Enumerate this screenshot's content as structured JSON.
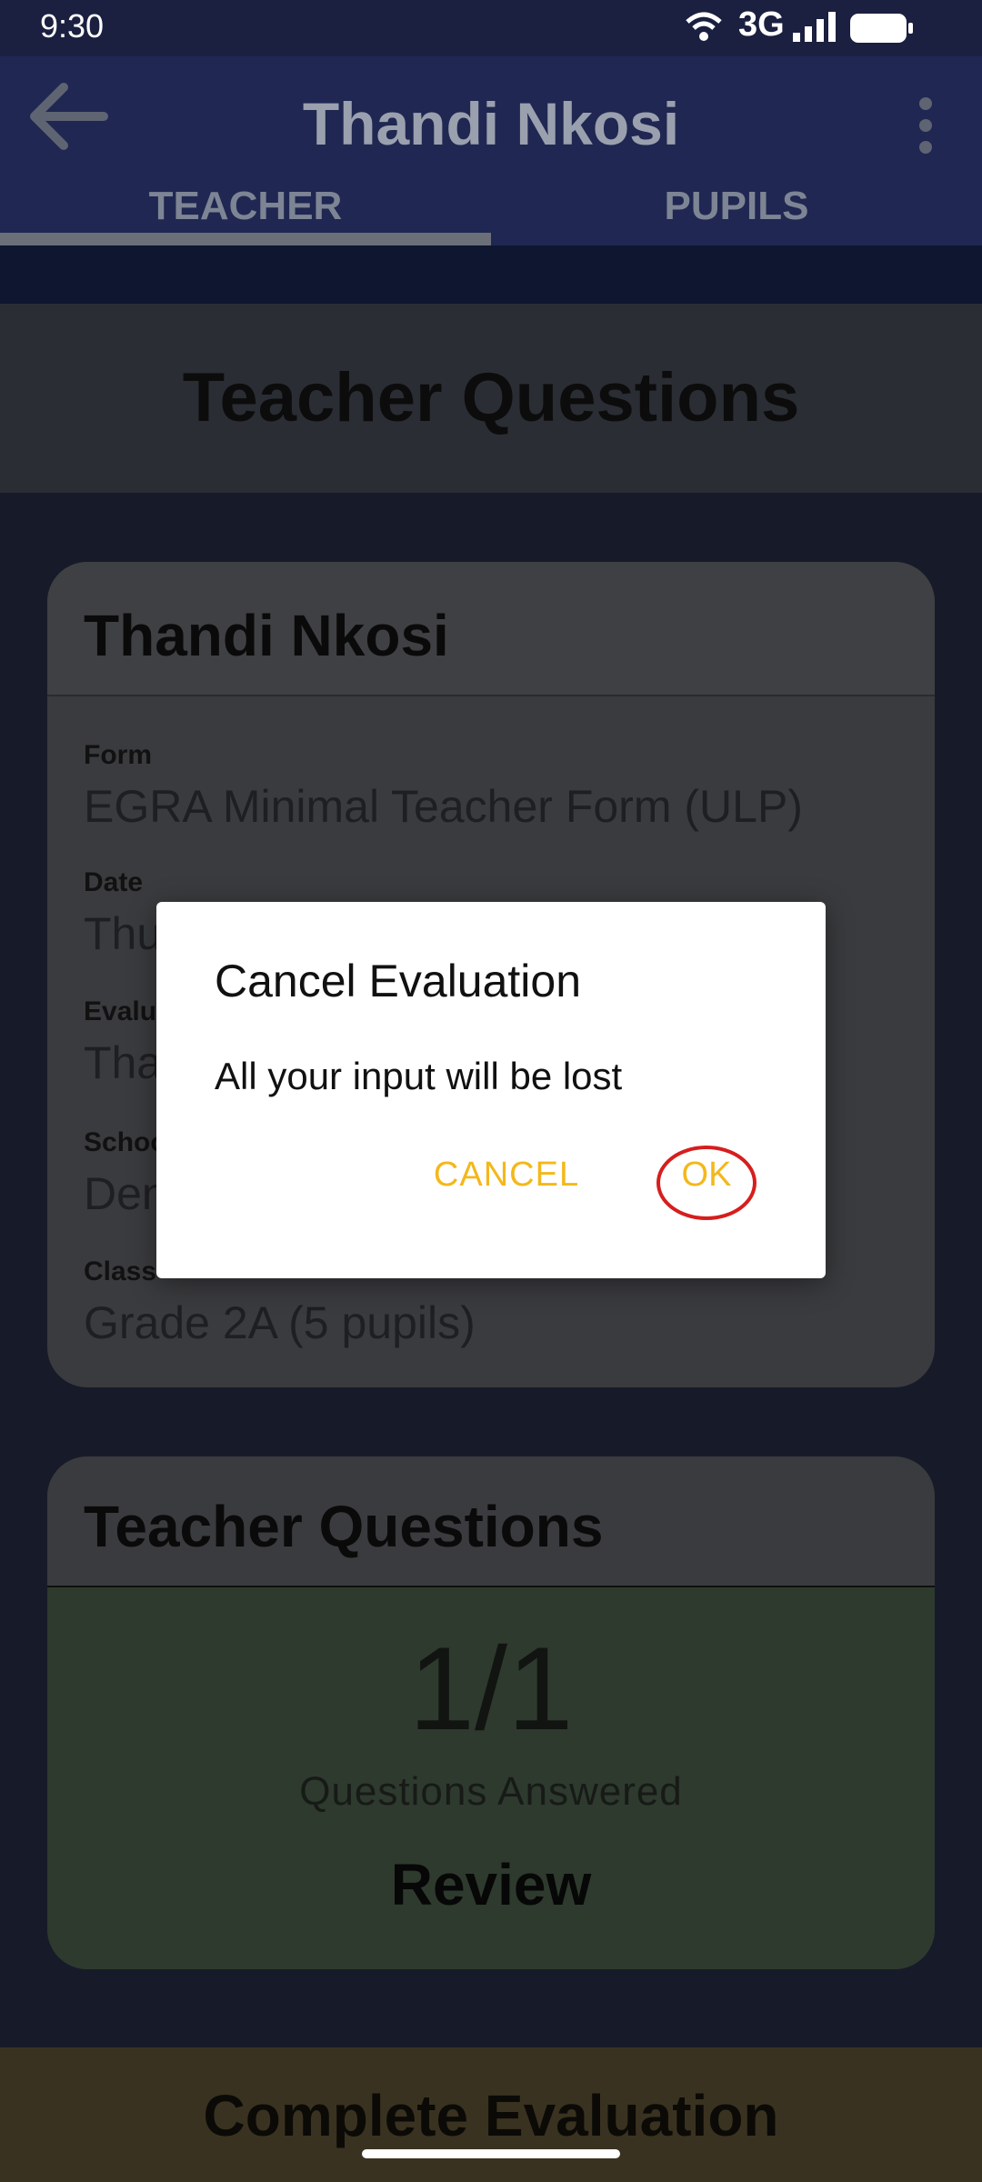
{
  "status_bar": {
    "time": "9:30",
    "network": "3G",
    "icons": [
      "wifi-icon",
      "signal-icon",
      "battery-icon"
    ]
  },
  "app_bar": {
    "title": "Thandi Nkosi",
    "back_icon": "arrow-back-icon",
    "menu_icon": "more-vert-icon"
  },
  "tabs": [
    {
      "label": "TEACHER",
      "selected": true
    },
    {
      "label": "PUPILS",
      "selected": false
    }
  ],
  "page_title": "Teacher Questions",
  "info_card": {
    "title": "Thandi Nkosi",
    "fields": [
      {
        "label": "Form",
        "value": "EGRA Minimal Teacher Form (ULP)"
      },
      {
        "label": "Date",
        "value": "Thu"
      },
      {
        "label": "Evalu",
        "value": "Tha"
      },
      {
        "label": "Schoo",
        "value": "Den"
      },
      {
        "label": "Class",
        "value": "Grade 2A (5 pupils)"
      }
    ]
  },
  "questions_card": {
    "title": "Teacher Questions",
    "count": "1/1",
    "caption": "Questions Answered",
    "action": "Review"
  },
  "bottom_action": "Complete Evaluation",
  "dialog": {
    "title": "Cancel Evaluation",
    "message": "All your input will be lost",
    "cancel_label": "CANCEL",
    "ok_label": "OK"
  },
  "colors": {
    "accent": "#f3b81b",
    "highlight": "#d61e1e",
    "app_bar": "#1f2752"
  }
}
